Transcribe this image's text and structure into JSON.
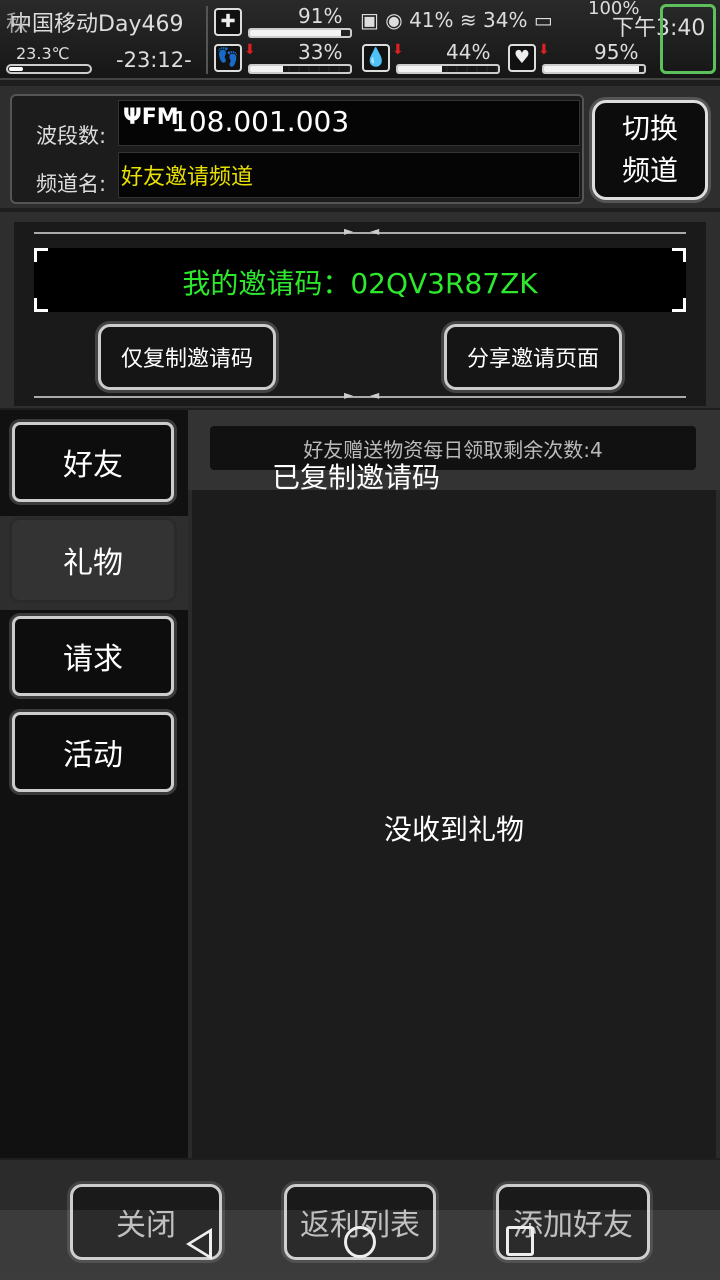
{
  "status": {
    "carrier_overlay": "秋",
    "carrier": "中国移动",
    "day": "Day469",
    "temperature": "23.3℃",
    "game_time": "-23:12-",
    "system_time": "下午3:40",
    "sys_battery": "100%",
    "sys_signal": "41%",
    "sys_extra": "34%",
    "stats": [
      {
        "name": "health",
        "icon": "✚",
        "value": "91%",
        "level": 0.91
      },
      {
        "name": "stamina",
        "icon": "👣",
        "value": "33%",
        "level": 0.33
      },
      {
        "name": "water",
        "icon": "💧",
        "value": "44%",
        "level": 0.44
      },
      {
        "name": "heart",
        "icon": "♥",
        "value": "95%",
        "level": 0.95
      }
    ]
  },
  "channel": {
    "band_label": "波段数:",
    "fm_icon": "ΨFM",
    "frequency": "108.001.003",
    "name_label": "频道名:",
    "name_value": "好友邀请频道",
    "switch_label_1": "切换",
    "switch_label_2": "频道"
  },
  "invite": {
    "code_text": "我的邀请码：02QV3R87ZK",
    "copy_button": "仅复制邀请码",
    "share_button": "分享邀请页面"
  },
  "tabs": [
    {
      "label": "好友"
    },
    {
      "label": "礼物"
    },
    {
      "label": "请求"
    },
    {
      "label": "活动"
    }
  ],
  "content": {
    "notice": "好友赠送物资每日领取剩余次数:4",
    "empty": "没收到礼物",
    "toast": "已复制邀请码"
  },
  "bottom": {
    "close": "关闭",
    "rebate": "返利列表",
    "add_friend": "添加好友"
  },
  "colors": {
    "code_green": "#2ee82e",
    "channel_yellow": "#e8e000",
    "corner_green": "#5cc05c"
  }
}
